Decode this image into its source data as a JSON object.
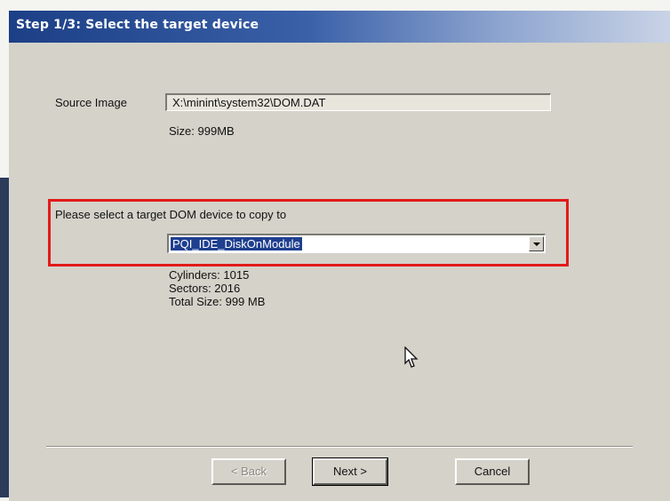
{
  "window": {
    "title": "Step 1/3: Select the target device"
  },
  "source": {
    "label": "Source Image",
    "path": "X:\\minint\\system32\\DOM.DAT",
    "size": "Size: 999MB"
  },
  "target": {
    "prompt": "Please select a target DOM device to copy to",
    "selected_device": "PQI_IDE_DiskOnModule",
    "cylinders": "Cylinders: 1015",
    "sectors": "Sectors: 2016",
    "total_size": "Total Size: 999 MB"
  },
  "buttons": {
    "back": "< Back",
    "next": "Next >",
    "cancel": "Cancel"
  },
  "colors": {
    "titlebar": "#1c3f86",
    "highlight": "#e21a1a",
    "selection": "#1f3f8f",
    "dialog_bg": "#d4d2c9"
  },
  "icons": {
    "dropdown": "chevron-down-icon",
    "cursor": "mouse-pointer-icon"
  }
}
